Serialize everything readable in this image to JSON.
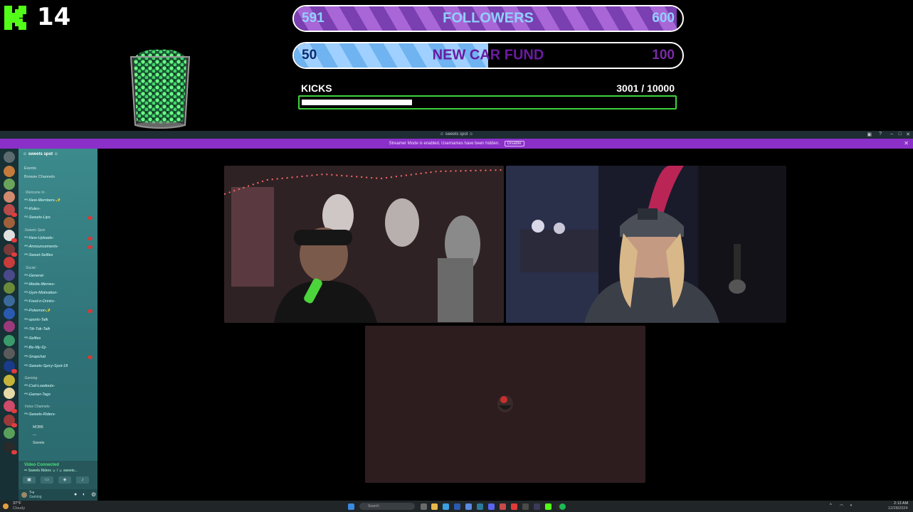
{
  "overlay": {
    "kick_count": "14",
    "followers_goal": {
      "title": "FOLLOWERS",
      "current": "591",
      "target": "600",
      "progress": 0.985
    },
    "car_goal": {
      "title": "NEW CAR FUND",
      "current": "50",
      "target": "100",
      "progress": 0.5
    },
    "kicks": {
      "label": "KICKS",
      "value": "3001  / 10000",
      "progress": 0.3
    },
    "colors": {
      "kick_green": "#53fc18",
      "followers_fill": "#8f4ed0",
      "car_fill": "#7ec0f6",
      "kicks_border": "#3ed33e"
    }
  },
  "window": {
    "title": "☺ sweets spot ☺",
    "banner": {
      "message": "Streamer Mode is enabled. Usernames have been hidden.",
      "button": "Disable"
    }
  },
  "sidebar": {
    "server_name": "☺ sweets spot ☺",
    "nav": [
      "Events",
      "Browse Channels"
    ],
    "categories": [
      {
        "name": "· Welcome In ·",
        "channels": [
          "ʷᵉ-New-Members-✨",
          "ʷᵉ-Rules-",
          "ʷᵉ-Sweets-Lips"
        ]
      },
      {
        "name": "·Sweets Spot·",
        "channels": [
          "ʷᵉ-New-Uploads-",
          "ʷᵉ-Announcements-",
          "ʷᵉ-Sweet-Selfies"
        ]
      },
      {
        "name": "· Social ·",
        "channels": [
          "ʷᵉ-General-",
          "ʷᵉ-Media-Memes-",
          "ʷᵉ-Gym-Motivation-",
          "ʷᵉ-Food-n-Drinks-",
          "ʷᵉ-Pokemon✨",
          "ʷᵉ-sports-Talk",
          "ʷᵉ-Tik-Tok-Talk",
          "ʷᵉ-Selfies",
          "ʷᵉ-Be-My-Dj-",
          "ʷᵉ-Snapchat",
          "ʷᵉ-Sweets-Spicy-Spot-18"
        ]
      },
      {
        "name": "·Gaming·",
        "channels": [
          "ʷᵉ-Cod-Loadouts-",
          "ʷᵉ-Gamer-Tags"
        ]
      },
      {
        "name": "·Voice Channels·",
        "channels": [
          "ʷᵉ-Sweets-Riders-"
        ]
      }
    ],
    "voice_users": [
      "MOBB",
      "—",
      "Sweets"
    ],
    "voice_status": {
      "title": "Video Connected",
      "subtitle": "ʷᵉ Sweets Riders ☺ / ☺ sweets..."
    },
    "user": {
      "name": "T•s",
      "status": "Gaming"
    }
  },
  "taskbar": {
    "weather_temp": "37°F",
    "weather_desc": "Cloudy",
    "search_placeholder": "Search",
    "time": "2:13 AM",
    "date": "12/28/2024"
  }
}
